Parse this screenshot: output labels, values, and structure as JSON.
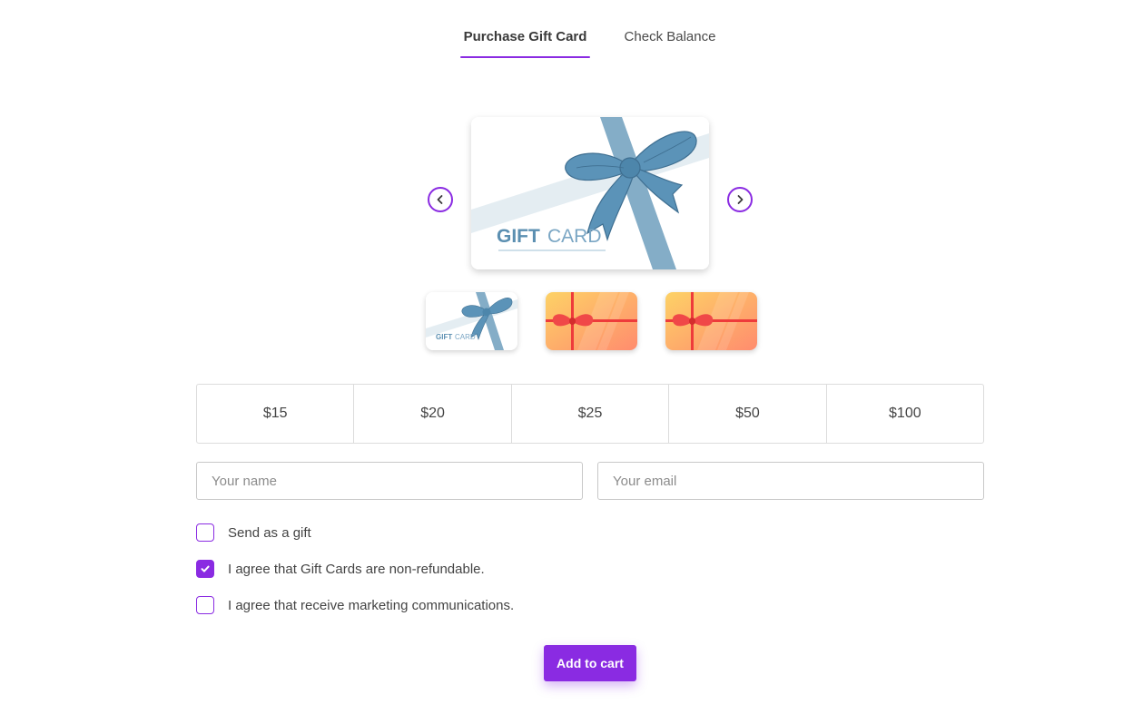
{
  "tabs": {
    "purchase": "Purchase Gift Card",
    "balance": "Check Balance"
  },
  "card": {
    "main_text_bold": "GIFT",
    "main_text_light": "CARD",
    "thumb_text_bold": "GIFT",
    "thumb_text_light": "CARD",
    "selected_index": 0
  },
  "amounts": [
    "$15",
    "$20",
    "$25",
    "$50",
    "$100"
  ],
  "form": {
    "name_placeholder": "Your name",
    "name_value": "",
    "email_placeholder": "Your email",
    "email_value": ""
  },
  "checkboxes": [
    {
      "label": "Send as a gift",
      "checked": false
    },
    {
      "label": "I agree that Gift Cards are non-refundable.",
      "checked": true
    },
    {
      "label": "I agree that receive marketing communications.",
      "checked": false
    }
  ],
  "button": {
    "add_to_cart": "Add to cart"
  },
  "colors": {
    "accent": "#8a2be2",
    "ribbon_blue": "#5b93b8",
    "card_orange_start": "#fdd266",
    "card_orange_end": "#ff8c6e",
    "ribbon_red": "#ee3b3b"
  },
  "icons": {
    "prev": "chevron-left-icon",
    "next": "chevron-right-icon",
    "check": "checkmark-icon"
  }
}
